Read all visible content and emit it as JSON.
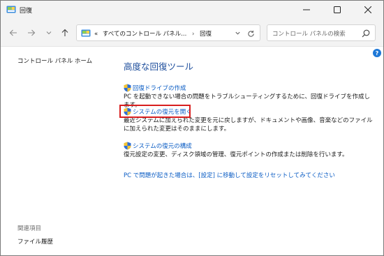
{
  "window": {
    "title": "回復",
    "icon": "control-panel-icon",
    "controls": {
      "minimize": "minimize-icon",
      "maximize": "maximize-icon",
      "close": "close-icon"
    }
  },
  "nav": {
    "back": "arrow-left-icon",
    "forward": "arrow-right-icon",
    "recent": "chevron-down-icon",
    "up": "arrow-up-icon"
  },
  "address": {
    "overflow": "«",
    "crumbs": [
      "すべてのコントロール パネル...",
      "回復"
    ],
    "separator": "›"
  },
  "search": {
    "placeholder": "コントロール パネルの検索"
  },
  "help": {
    "label": "?"
  },
  "left_pane": {
    "home_link": "コントロール パネル ホーム",
    "related_title": "関連項目",
    "related_links": [
      "ファイル履歴"
    ]
  },
  "main": {
    "title": "高度な回復ツール",
    "tasks": [
      {
        "link": "回復ドライブの作成",
        "description": "PC を起動できない場合の問題をトラブルシューティングするために、回復ドライブを作成します。"
      },
      {
        "link": "システムの復元を開く",
        "description": "最近システムに加えられた変更を元に戻しますが、ドキュメントや画像、音楽などのファイルに加えられた変更はそのままにします。"
      },
      {
        "link": "システムの復元の構成",
        "description": "復元設定の変更、ディスク領域の管理、復元ポイントの作成または削除を行います。"
      }
    ],
    "reset_link": "PC で問題が起きた場合は、[設定] に移動して設定をリセットしてみてください"
  },
  "colors": {
    "link": "#0a5cc4",
    "title": "#1e4e9c",
    "highlight": "#d81e1e",
    "chrome": "#f3f3f3"
  }
}
